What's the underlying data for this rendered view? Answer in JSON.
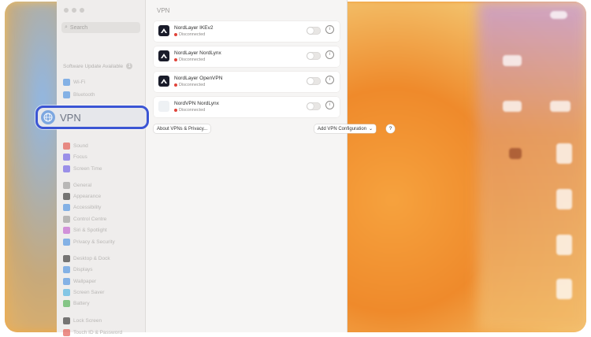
{
  "window": {
    "search_placeholder": "Search",
    "software_update": "Software Update Available",
    "software_update_count": "1",
    "content_title": "VPN"
  },
  "sidebar": {
    "items": [
      {
        "label": "Wi-Fi",
        "icon": "wifi-icon",
        "color": "#4a90e2"
      },
      {
        "label": "Bluetooth",
        "icon": "bluetooth-icon",
        "color": "#4a90e2"
      },
      {
        "label": "Sound",
        "icon": "sound-icon",
        "color": "#e2534a"
      },
      {
        "label": "Focus",
        "icon": "focus-icon",
        "color": "#6c5ce7"
      },
      {
        "label": "Screen Time",
        "icon": "screen-time-icon",
        "color": "#6c5ce7"
      },
      {
        "label": "General",
        "icon": "gear-icon",
        "color": "#9a9a9a"
      },
      {
        "label": "Appearance",
        "icon": "appearance-icon",
        "color": "#333333"
      },
      {
        "label": "Accessibility",
        "icon": "accessibility-icon",
        "color": "#4a90e2"
      },
      {
        "label": "Control Centre",
        "icon": "control-centre-icon",
        "color": "#9a9a9a"
      },
      {
        "label": "Siri & Spotlight",
        "icon": "siri-icon",
        "color": "#c05fd0"
      },
      {
        "label": "Privacy & Security",
        "icon": "hand-icon",
        "color": "#4a90e2"
      },
      {
        "label": "Desktop & Dock",
        "icon": "dock-icon",
        "color": "#333333"
      },
      {
        "label": "Displays",
        "icon": "display-icon",
        "color": "#4a90e2"
      },
      {
        "label": "Wallpaper",
        "icon": "wallpaper-icon",
        "color": "#4a90e2"
      },
      {
        "label": "Screen Saver",
        "icon": "screen-saver-icon",
        "color": "#4ab0e2"
      },
      {
        "label": "Battery",
        "icon": "battery-icon",
        "color": "#4caf50"
      },
      {
        "label": "Lock Screen",
        "icon": "lock-icon",
        "color": "#333333"
      },
      {
        "label": "Touch ID & Password",
        "icon": "fingerprint-icon",
        "color": "#e2534a"
      }
    ],
    "highlight_label": "VPN"
  },
  "vpn_configs": [
    {
      "name": "NordLayer IKEv2",
      "status": "Disconnected",
      "logo": "nordlayer-icon"
    },
    {
      "name": "NordLayer NordLynx",
      "status": "Disconnected",
      "logo": "nordlayer-icon"
    },
    {
      "name": "NordLayer OpenVPN",
      "status": "Disconnected",
      "logo": "nordlayer-icon"
    },
    {
      "name": "NordVPN NordLynx",
      "status": "Disconnected",
      "logo": "nordvpn-icon"
    }
  ],
  "buttons": {
    "about": "About VPNs & Privacy...",
    "add": "Add VPN Configuration",
    "add_chevron": "⌄",
    "help": "?"
  },
  "colors": {
    "highlight_border": "#3b55d4",
    "status_disconnected": "#e0443a"
  }
}
